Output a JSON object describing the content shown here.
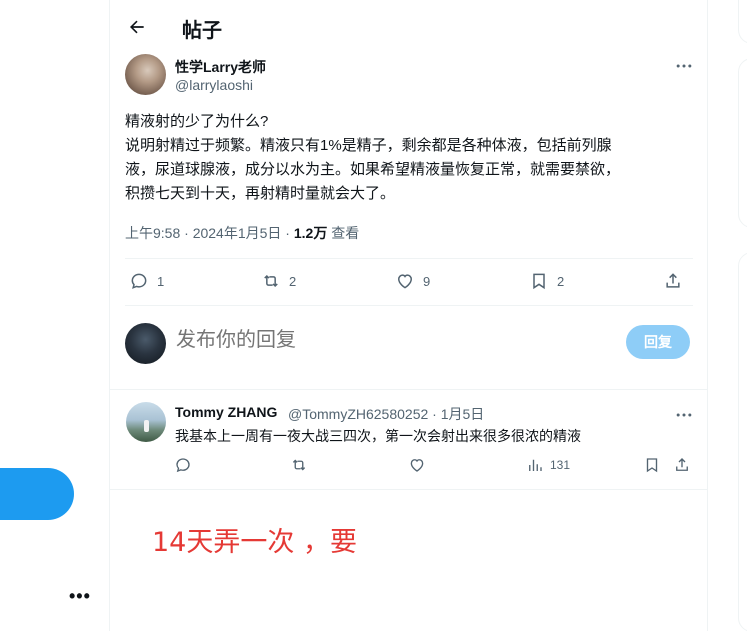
{
  "header": {
    "title": "帖子"
  },
  "author": {
    "name": "性学Larry老师",
    "handle": "@larrylaoshi"
  },
  "tweet": {
    "lines": [
      "精液射的少了为什么?",
      "说明射精过于频繁。精液只有1%是精子，剩余都是各种体液，包括前列腺",
      "液，尿道球腺液，成分以水为主。如果希望精液量恢复正常，就需要禁欲，",
      "积攒七天到十天，再射精时量就会大了。"
    ],
    "time": "上午9:58 · 2024年1月5日 · ",
    "views": "1.2万",
    "views_label": " 查看",
    "stats": {
      "replies": "1",
      "retweets": "2",
      "likes": "9",
      "bookmarks": "2"
    }
  },
  "composer": {
    "placeholder": "发布你的回复",
    "button": "回复"
  },
  "reply": {
    "name": "Tommy ZHANG",
    "handle": "@TommyZH62580252 · 1月5日",
    "text": "我基本上一周有一夜大战三四次，第一次会射出来很多很浓的精液",
    "views": "131"
  },
  "annotation": "14天弄一次 ，要",
  "colors": {
    "accent": "#1d9bf0",
    "secondary_text": "#536471",
    "annotation": "#e53935"
  }
}
